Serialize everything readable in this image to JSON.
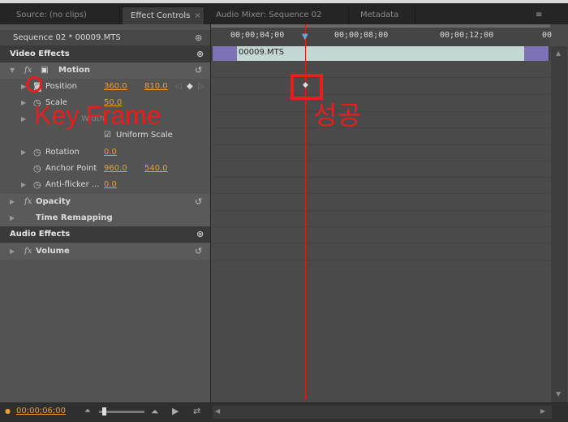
{
  "tabs": [
    {
      "label": "Source: (no clips)"
    },
    {
      "label": "Effect Controls",
      "close": "×"
    },
    {
      "label": "Audio Mixer: Sequence 02"
    },
    {
      "label": "Metadata"
    }
  ],
  "panel_menu_icon": "≡",
  "sequence_label": "Sequence 02 * 00009.MTS",
  "video_effects_label": "Video Effects",
  "audio_effects_label": "Audio Effects",
  "motion": {
    "label": "Motion",
    "position": {
      "label": "Position",
      "x": "360.0",
      "y": "810.0"
    },
    "scale": {
      "label": "Scale",
      "value": "50.0"
    },
    "scale_width": {
      "label": "Width"
    },
    "uniform_scale": {
      "label": "Uniform Scale",
      "checked": true
    },
    "rotation": {
      "label": "Rotation",
      "value": "0.0"
    },
    "anchor_point": {
      "label": "Anchor Point",
      "x": "960.0",
      "y": "540.0"
    },
    "anti_flicker": {
      "label": "Anti-flicker ...",
      "value": "0.0"
    }
  },
  "opacity_label": "Opacity",
  "time_remapping_label": "Time Remapping",
  "volume_label": "Volume",
  "timeline": {
    "ticks": [
      "00;00;04;00",
      "00;00;08;00",
      "00;00;12;00",
      "00"
    ],
    "clip_name": "00009.MTS"
  },
  "current_time": "00;00;06;00",
  "annotations": {
    "key_frame": "Key Frame",
    "success": "성공"
  },
  "colors": {
    "accent_value": "#e4a12c",
    "playhead": "#d42020",
    "annotation": "#e61e1e",
    "clip": "#c3d7d3"
  }
}
